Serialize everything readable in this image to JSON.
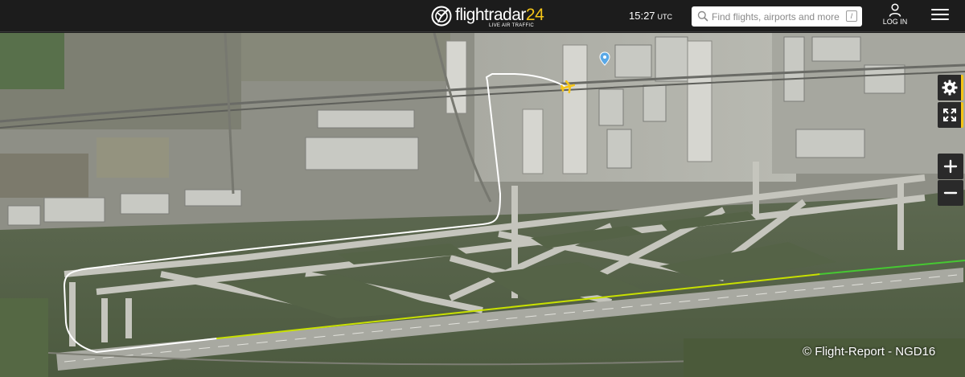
{
  "header": {
    "logo_name": "flightradar",
    "logo_number": "24",
    "logo_tagline": "LIVE AIR TRAFFIC",
    "time": "15:27",
    "timezone": "UTC",
    "login_label": "LOG IN"
  },
  "search": {
    "placeholder": "Find flights, airports and more",
    "shortcut_key": "/"
  },
  "map": {
    "view": "satellite",
    "copyright": "© Flight-Report - NGD16",
    "track_colors": [
      "#ffffff",
      "#c8e000",
      "#46c832"
    ],
    "aircraft_color": "#f5c518"
  },
  "controls": {
    "icons": [
      "gear-icon",
      "fullscreen-icon",
      "plus-icon",
      "minus-icon"
    ]
  },
  "colors": {
    "accent": "#f5c518",
    "topbar": "#1c1c1c"
  }
}
